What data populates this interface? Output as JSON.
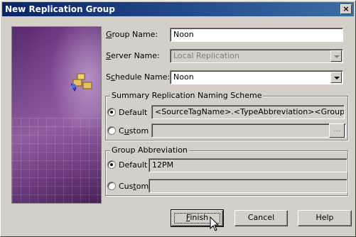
{
  "window": {
    "title": "New Replication Group",
    "close_glyph": "×"
  },
  "form": {
    "group_name": {
      "label_pre": "",
      "label_u": "G",
      "label_post": "roup Name:",
      "value": "Noon"
    },
    "server_name": {
      "label_pre": "",
      "label_u": "S",
      "label_post": "erver Name:",
      "value": "Local Replication"
    },
    "schedule_name": {
      "label_pre": "S",
      "label_u": "c",
      "label_post": "hedule Name:",
      "value": "Noon"
    }
  },
  "naming_scheme": {
    "title": "Summary Replication Naming Scheme",
    "default_label": "Default",
    "default_value": "<SourceTagName>.<TypeAbbreviation><GroupAbbre",
    "custom_label_pre": "C",
    "custom_label_u": "u",
    "custom_label_post": "stom",
    "custom_value": "",
    "browse_label": "..."
  },
  "group_abbreviation": {
    "title": "Group Abbreviation",
    "default_label": "Default",
    "default_value": "12PM",
    "custom_label_pre": "Cus",
    "custom_label_u": "t",
    "custom_label_post": "om",
    "custom_value": ""
  },
  "buttons": {
    "finish_pre": "",
    "finish_u": "F",
    "finish_post": "inish",
    "cancel": "Cancel",
    "help": "Help"
  },
  "icons": {
    "banner": "replication-icon"
  }
}
